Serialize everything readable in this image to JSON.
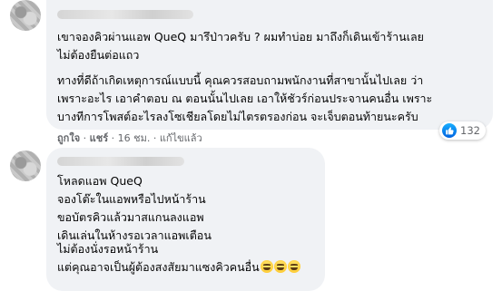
{
  "comment1": {
    "paragraph1": [
      "เขาจองคิวผ่านแอพ QueQ มารึป่าวครับ ? ผมทำบ่อย มาถึงก็เดินเข้าร้านเลย",
      "ไม่ต้องยืนต่อแถว"
    ],
    "paragraph2": [
      "ทางที่ดีถ้าเกิดเหตุการณ์แบบนี้ คุณควรสอบถามพนักงานที่สาขานั้นไปเลย ว่า",
      "เพราะอะไร เอาคำตอบ ณ ตอนนั้นไปเลย เอาให้ชัวร์ก่อนประจานคนอื่น เพราะ",
      "บางทีการโพสต์อะไรลงโซเชียลโดยไม่ไตรตรองก่อน จะเจ็บตอนท้ายนะครับ"
    ],
    "actions": {
      "like": "ถูกใจ",
      "reply": "แชร์",
      "time": "16 ชม.",
      "edited": "แก้ไขแล้ว"
    },
    "reaction_count": "132"
  },
  "comment2": {
    "paragraph1": [
      "โหลดแอพ QueQ",
      "จองโต๊ะในแอพหรือไปหน้าร้าน",
      "ขอบัตรคิวแล้วมาสแกนลงแอพ",
      "เดินเล่นในห้างรอเวลาแอพเตือน"
    ],
    "paragraph2": [
      "ไม่ต้องนั่งรอหน้าร้าน",
      "แต่คุณอาจเป็นผู้ต้องสงสัยมาแซงคิวคนอื่น"
    ],
    "emoji_count": 3
  },
  "colors": {
    "bubble": "#f0f2f5",
    "meta_text": "#65676b",
    "like_blue": "#1877f2"
  },
  "icons": [
    "like-icon",
    "grin-emoji-icon"
  ]
}
